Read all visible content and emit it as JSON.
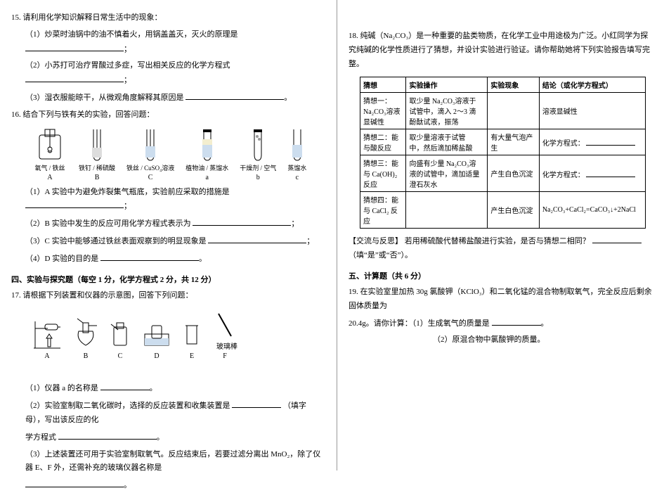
{
  "left": {
    "q15": {
      "num": "15.",
      "stem": "请利用化学知识解释日常生活中的现象：",
      "items": [
        "（1）炒菜时油锅中的油不慎着火，用锅盖盖灭，灭火的原理是",
        "（2）小苏打可治疗胃酸过多症，写出相关反应的化学方程式",
        "（3）湿衣服能晾干，从微观角度解释其原因是"
      ]
    },
    "q16": {
      "num": "16.",
      "stem": "结合下列与铁有关的实验，回答问题：",
      "labels": {
        "A": "A",
        "B": "B",
        "C": "C",
        "a": "a",
        "b": "b",
        "c": "c"
      },
      "annot": {
        "oxygen": "氧气",
        "ironwire": "铁丝",
        "ironnail": "铁钉",
        "dil_acid": "稀硫酸",
        "iron_wire2": "铁丝",
        "cuso4": "CuSO₄溶液",
        "veg_oil": "植物油",
        "distilled": "蒸馏水",
        "dry_agent": "干燥剂",
        "air": "空气",
        "dist2": "蒸馏水"
      },
      "subs": [
        "（1）A 实验中为避免炸裂集气瓶底，实验前应采取的措施是",
        "（2）B 实验中发生的反应可用化学方程式表示为",
        "（3）C 实验中能够通过铁丝表面观察到的明显现象是",
        "（4）D 实验的目的是"
      ]
    },
    "sec4": {
      "heading": "四、实验与探究题（每空 1 分，化学方程式 2 分，共 12 分）"
    },
    "q17": {
      "num": "17.",
      "stem": "请根据下列装置和仪器的示意图，回答下列问题：",
      "labels": {
        "A": "A",
        "B": "B",
        "C": "C",
        "D": "D",
        "E": "E",
        "F": "F"
      },
      "glass": "玻璃棒",
      "subs": [
        "（1）仪器 a 的名称是",
        "（2）实验室制取二氧化碳时，选择的反应装置和收集装置是",
        "学方程式",
        "（3）上述装置还可用于实验室制取氧气。反应结束后，若要过滤分离出 MnO₂，除了仪器 E、F 外，还需补充的玻璃仪器名称是"
      ],
      "fill_hint": "（填字母），写出该反应的化"
    }
  },
  "right": {
    "q18": {
      "num": "18.",
      "stem": "纯碱（Na₂CO₃）是一种重要的盐类物质，在化学工业中用途极为广泛。小红同学为探究纯碱的化学性质进行了猜想，并设计实验进行验证。请你帮助她将下列实验报告填写完整。",
      "th": {
        "guess": "猜想",
        "op": "实验操作",
        "ph": "实验现象",
        "concl": "结论（或化学方程式）"
      },
      "r1": {
        "g1": "猜想一：",
        "g2": "Na₂CO₃溶液",
        "g3": "显碱性",
        "op1": "取少量 Na₂CO₃溶液于",
        "op2": "试管中，滴入 2～3 滴",
        "op3": "酚酞试液，振荡",
        "cc": "溶液显碱性"
      },
      "r2": {
        "g1": "猜想二：能",
        "g2": "与酸反应",
        "op1": "取少量溶液于试管",
        "op2": "中，然后滴加稀盐酸",
        "ph1": "有大量气泡产",
        "ph2": "生",
        "cc": "化学方程式："
      },
      "r3": {
        "g1": "猜想三：能",
        "g2": "与 Ca(OH)₂",
        "g3": "反应",
        "op1": "向盛有少量 Na₂CO₃溶",
        "op2": "液的试管中，滴加适量",
        "op3": "澄石灰水",
        "ph": "产生白色沉淀",
        "cc": "化学方程式："
      },
      "r4": {
        "g1": "猜想四：能",
        "g2": "与 CaCl₂ 反",
        "g3": "应",
        "ph": "产生白色沉淀",
        "cc": "Na₂CO₃+CaCl₂=CaCO₃↓+2NaCl"
      },
      "reflect_label": "【交流与反思】",
      "reflect": "若用稀硫酸代替稀盐酸进行实验，是否与猜想二相同？",
      "reflect_hint": "（填“是”或“否”）。"
    },
    "sec5": {
      "heading": "五、计算题（共 6 分）"
    },
    "q19": {
      "num": "19.",
      "stem": "在实验室里加热 30g 氯酸钾（KClO₃）和二氧化锰的混合物制取氧气，完全反应后剩余固体质量为",
      "line2": "20.4g。请你计算：（1）生成氧气的质量是",
      "line3": "（2）原混合物中氯酸钾的质量。"
    }
  }
}
